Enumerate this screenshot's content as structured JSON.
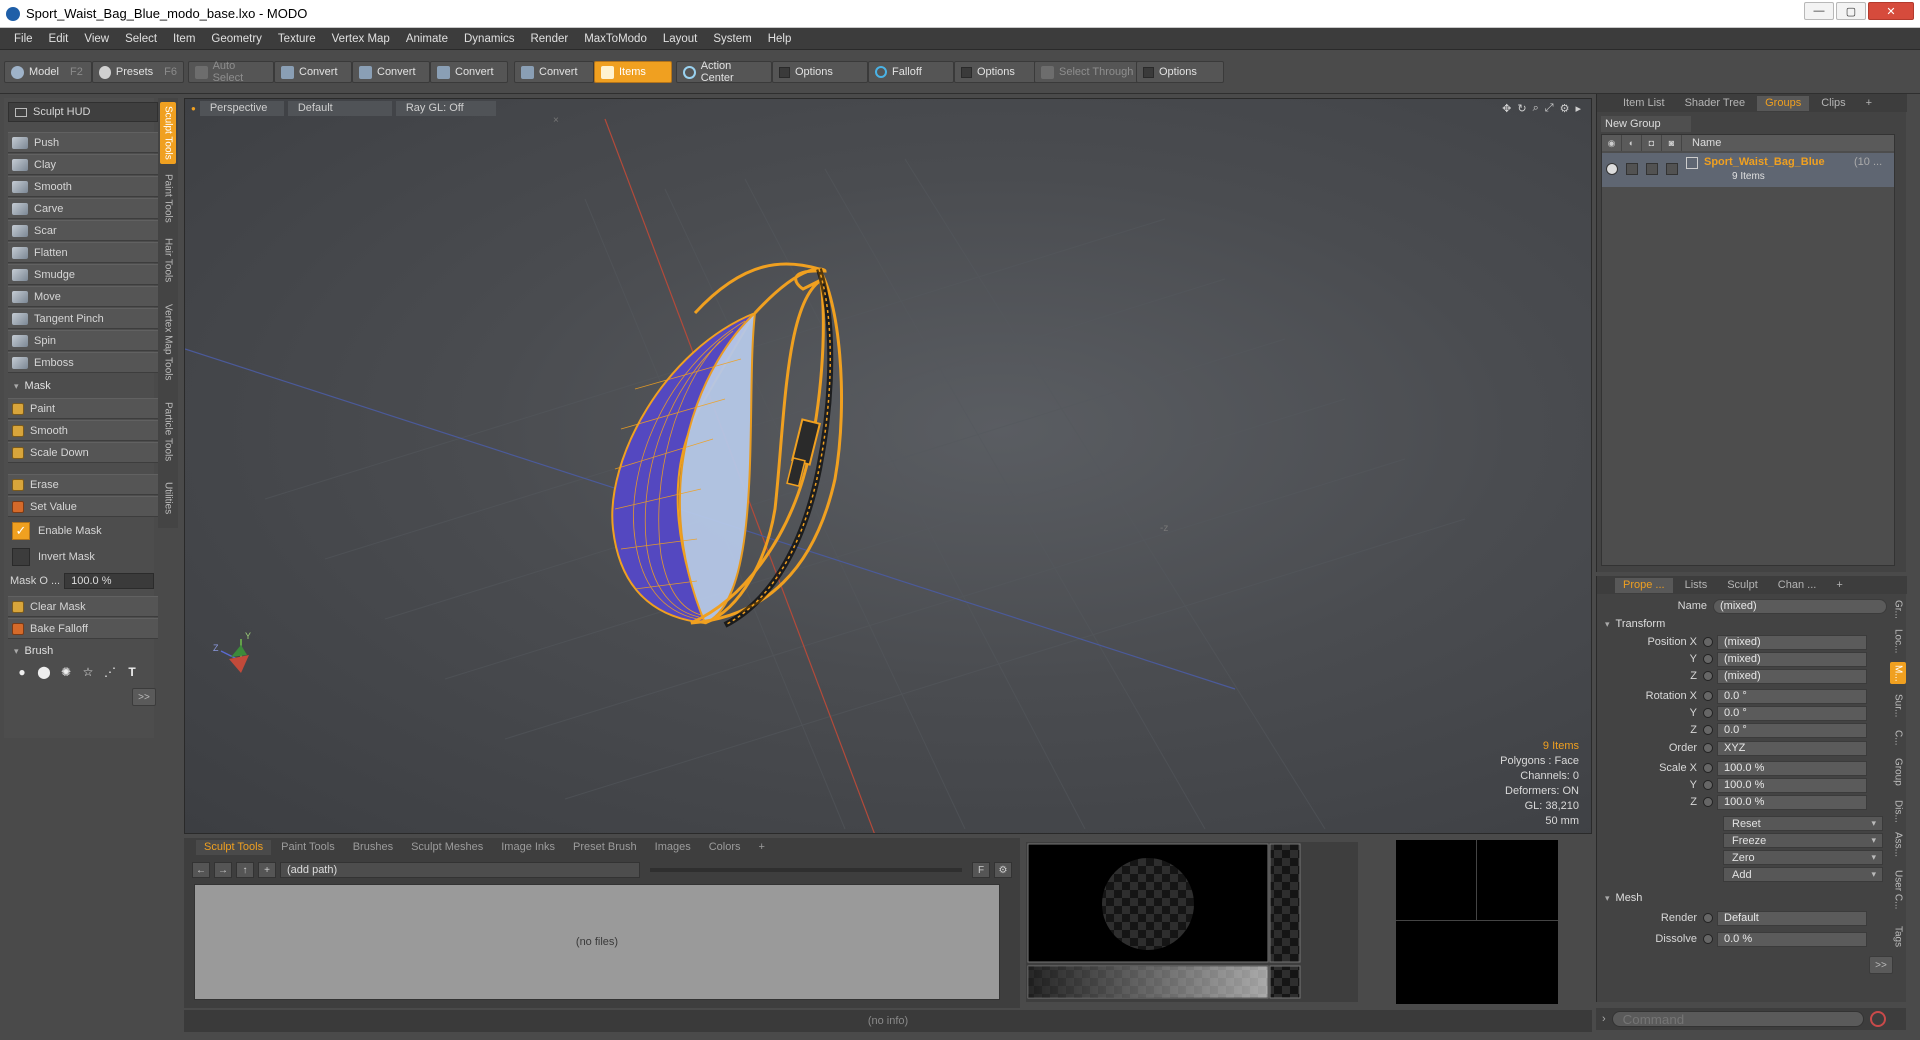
{
  "window": {
    "title": "Sport_Waist_Bag_Blue_modo_base.lxo - MODO",
    "minimize": "—",
    "maximize": "▢",
    "close": "✕"
  },
  "menu": [
    "File",
    "Edit",
    "View",
    "Select",
    "Item",
    "Geometry",
    "Texture",
    "Vertex Map",
    "Animate",
    "Dynamics",
    "Render",
    "MaxToModo",
    "Layout",
    "System",
    "Help"
  ],
  "toolbar": {
    "model": "Model",
    "model_key": "F2",
    "presets": "Presets",
    "presets_key": "F6",
    "auto_select": "Auto Select",
    "convert1": "Convert",
    "convert2": "Convert",
    "convert3": "Convert",
    "convert4": "Convert",
    "items": "Items",
    "action_center": "Action Center",
    "options1": "Options",
    "falloff": "Falloff",
    "options2": "Options",
    "select_through": "Select Through",
    "options3": "Options"
  },
  "left": {
    "hud": "Sculpt HUD",
    "tools": [
      "Push",
      "Clay",
      "Smooth",
      "Carve",
      "Scar",
      "Flatten",
      "Smudge",
      "Move",
      "Tangent Pinch",
      "Spin",
      "Emboss"
    ],
    "mask_section": "Mask",
    "mask_tools": [
      "Paint",
      "Smooth",
      "Scale Down"
    ],
    "erase": "Erase",
    "set_value": "Set Value",
    "enable_mask": "Enable Mask",
    "invert_mask": "Invert Mask",
    "mask_opacity_label": "Mask O ...",
    "mask_opacity_value": "100.0 %",
    "clear_mask": "Clear Mask",
    "bake_falloff": "Bake Falloff",
    "brush_section": "Brush",
    "more": ">>"
  },
  "vtabs": [
    "Sculpt Tools",
    "Paint Tools",
    "Hair Tools",
    "Vertex Map Tools",
    "Particle Tools",
    "Utilities"
  ],
  "viewport": {
    "tab_perspective": "Perspective",
    "tab_default": "Default",
    "tab_raygl": "Ray GL: Off",
    "stats": {
      "items": "9 Items",
      "polygons": "Polygons : Face",
      "channels": "Channels: 0",
      "deformers": "Deformers: ON",
      "gl": "GL: 38,210",
      "units": "50 mm"
    }
  },
  "bottom": {
    "tabs": [
      "Sculpt Tools",
      "Paint Tools",
      "Brushes",
      "Sculpt Meshes",
      "Image Inks",
      "Preset Brush",
      "Images",
      "Colors",
      "+"
    ],
    "path": "(add path)",
    "f_btn": "F",
    "no_files": "(no files)"
  },
  "status": "(no info)",
  "right": {
    "tabs": [
      "Item List",
      "Shader Tree",
      "Groups",
      "Clips",
      "+"
    ],
    "new_group": "New Group",
    "name_header": "Name",
    "group_name": "Sport_Waist_Bag_Blue",
    "group_extra": "(10 ...",
    "group_count": "9 Items",
    "prop_tabs": [
      "Prope ...",
      "Lists",
      "Sculpt",
      "Chan ...",
      "+"
    ],
    "name_label": "Name",
    "name_value": "(mixed)",
    "transform": "Transform",
    "position_x_label": "Position X",
    "position_x": "(mixed)",
    "position_y_label": "Y",
    "position_y": "(mixed)",
    "position_z_label": "Z",
    "position_z": "(mixed)",
    "rotation_x_label": "Rotation X",
    "rotation_x": "0.0 °",
    "rotation_y_label": "Y",
    "rotation_y": "0.0 °",
    "rotation_z_label": "Z",
    "rotation_z": "0.0 °",
    "order_label": "Order",
    "order": "XYZ",
    "scale_x_label": "Scale X",
    "scale_x": "100.0 %",
    "scale_y_label": "Y",
    "scale_y": "100.0 %",
    "scale_z_label": "Z",
    "scale_z": "100.0 %",
    "reset": "Reset",
    "freeze": "Freeze",
    "zero": "Zero",
    "add": "Add",
    "mesh": "Mesh",
    "render_label": "Render",
    "render": "Default",
    "dissolve_label": "Dissolve",
    "dissolve": "0.0 %",
    "more": ">>",
    "side_tabs": [
      "Gr...",
      "Loc...",
      "M...",
      "Sur...",
      "C...",
      "Group",
      "Dis...",
      "Ass...",
      "User C...",
      "Tags"
    ],
    "command_placeholder": "Command"
  },
  "colors": {
    "accent": "#f0a020",
    "wire": "#f0a020",
    "wire_blue": "#5a50c8"
  }
}
